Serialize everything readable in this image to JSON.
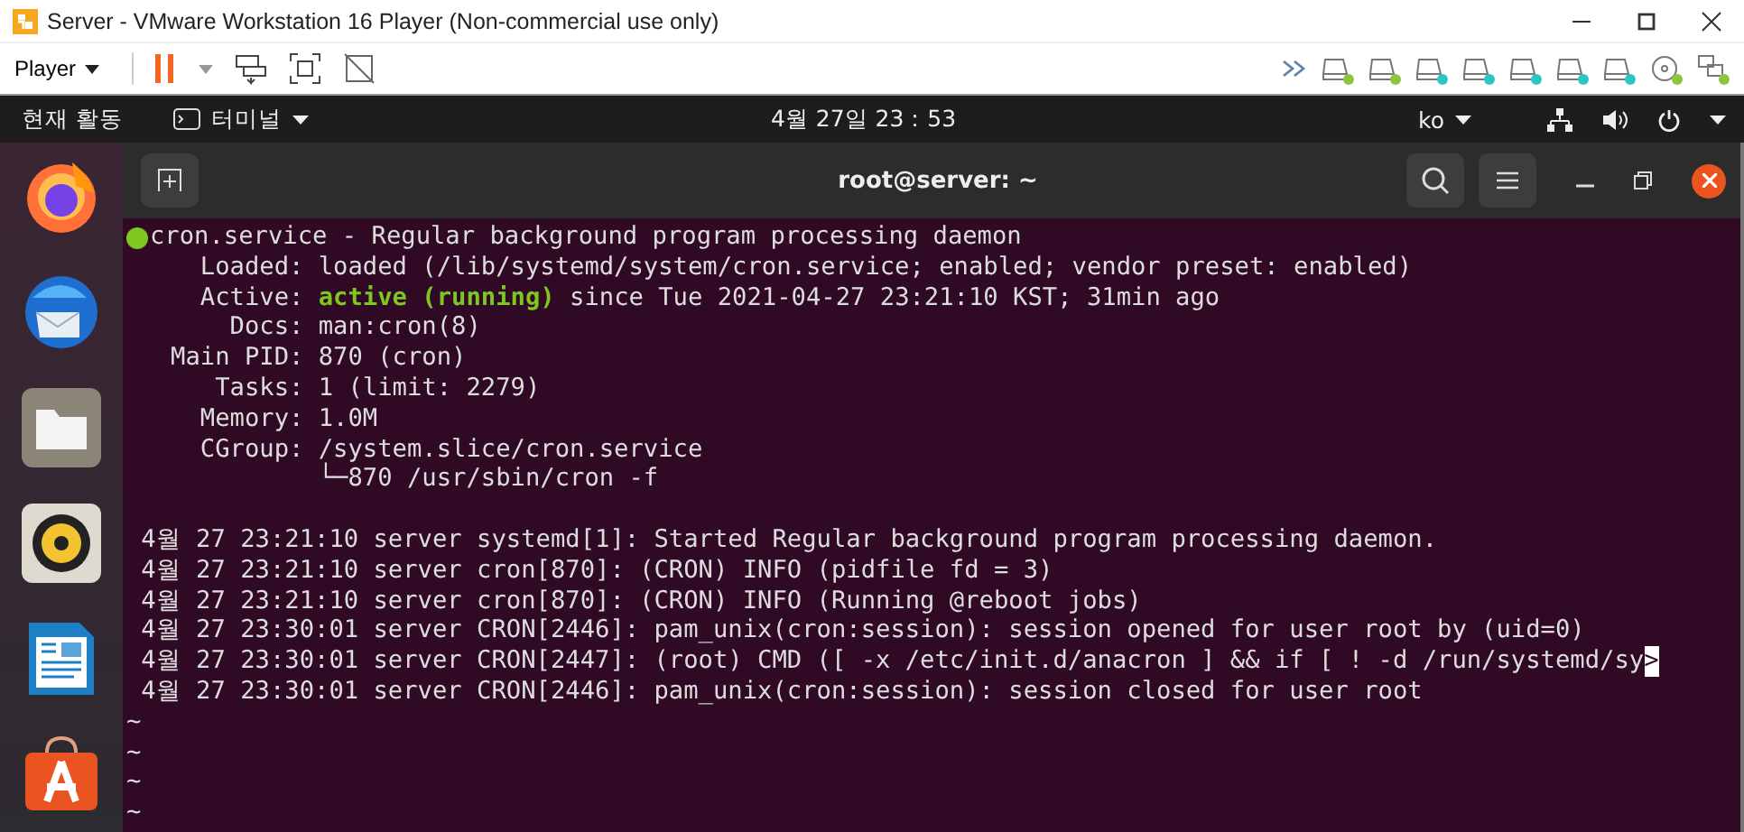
{
  "window": {
    "title": "Server - VMware Workstation 16 Player (Non-commercial use only)"
  },
  "toolbar": {
    "menu": "Player",
    "devices": [
      {
        "kind": "disk",
        "color": "#8cc63f"
      },
      {
        "kind": "disk",
        "color": "#8cc63f"
      },
      {
        "kind": "disk",
        "color": "#2ec4c4"
      },
      {
        "kind": "disk",
        "color": "#2ec4c4"
      },
      {
        "kind": "disk",
        "color": "#2ec4c4"
      },
      {
        "kind": "disk",
        "color": "#2ec4c4"
      },
      {
        "kind": "disk",
        "color": "#2ec4c4"
      },
      {
        "kind": "cd",
        "color": "#8cc63f"
      },
      {
        "kind": "network",
        "color": "#8cc63f"
      }
    ]
  },
  "topbar": {
    "activities": "현재 활동",
    "app_menu": "터미널",
    "clock": "4월 27일 23：53",
    "input_method": "ko"
  },
  "terminal": {
    "title": "root@server: ~",
    "unit": {
      "active": true,
      "title": "cron.service - Regular background program processing daemon"
    },
    "fields": [
      {
        "label": "Loaded:",
        "segments": [
          {
            "text": "loaded (/lib/systemd/system/cron.service; enabled; vendor preset: enabled)",
            "kind": "plain"
          }
        ]
      },
      {
        "label": "Active:",
        "segments": [
          {
            "text": "active (running)",
            "kind": "active"
          },
          {
            "text": " since Tue 2021-04-27 23:21:10 KST; 31min ago",
            "kind": "plain"
          }
        ]
      },
      {
        "label": "Docs:",
        "segments": [
          {
            "text": "man:cron(8)",
            "kind": "plain"
          }
        ]
      },
      {
        "label": "Main PID:",
        "segments": [
          {
            "text": "870 (cron)",
            "kind": "plain"
          }
        ]
      },
      {
        "label": "Tasks:",
        "segments": [
          {
            "text": "1 (limit: 2279)",
            "kind": "plain"
          }
        ]
      },
      {
        "label": "Memory:",
        "segments": [
          {
            "text": "1.0M",
            "kind": "plain"
          }
        ]
      },
      {
        "label": "CGroup:",
        "segments": [
          {
            "text": "/system.slice/cron.service",
            "kind": "plain"
          }
        ]
      },
      {
        "segments": [
          {
            "text": "└─870 /usr/sbin/cron -f",
            "kind": "plain"
          }
        ]
      }
    ],
    "log_lines": [
      {
        "text": "4월 27 23:21:10 server systemd[1]: Started Regular background program processing daemon."
      },
      {
        "text": "4월 27 23:21:10 server cron[870]: (CRON) INFO (pidfile fd = 3)"
      },
      {
        "text": "4월 27 23:21:10 server cron[870]: (CRON) INFO (Running @reboot jobs)"
      },
      {
        "text": "4월 27 23:30:01 server CRON[2446]: pam_unix(cron:session): session opened for user root by (uid=0)"
      },
      {
        "text": "4월 27 23:30:01 server CRON[2447]: (root) CMD ([ -x /etc/init.d/anacron ] && if [ ! -d /run/systemd/sy",
        "cut_marker": ">"
      },
      {
        "text": "4월 27 23:30:01 server CRON[2446]: pam_unix(cron:session): session closed for user root"
      }
    ],
    "empty_markers": [
      "~",
      "~",
      "~",
      "~"
    ]
  }
}
